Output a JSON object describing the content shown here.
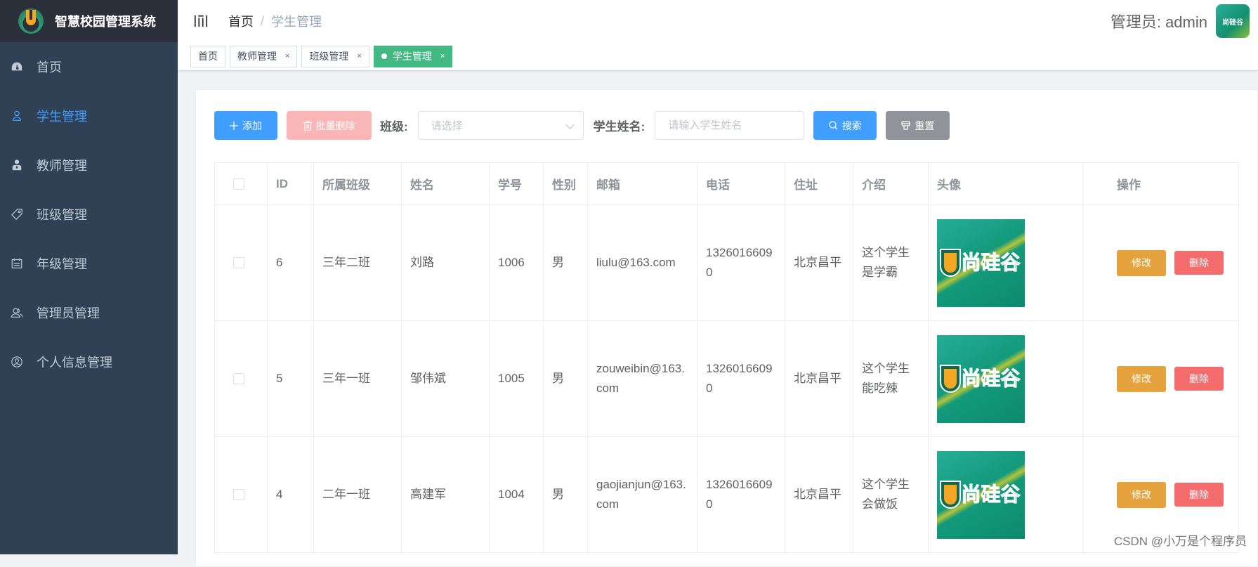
{
  "app": {
    "title": "智慧校园管理系统"
  },
  "sidebar": {
    "items": [
      {
        "label": "首页",
        "icon": "dashboard-icon",
        "active": false
      },
      {
        "label": "学生管理",
        "icon": "user-icon",
        "active": true
      },
      {
        "label": "教师管理",
        "icon": "teacher-icon",
        "active": false
      },
      {
        "label": "班级管理",
        "icon": "tag-icon",
        "active": false
      },
      {
        "label": "年级管理",
        "icon": "calendar-icon",
        "active": false
      },
      {
        "label": "管理员管理",
        "icon": "users-icon",
        "active": false
      },
      {
        "label": "个人信息管理",
        "icon": "user-circle-icon",
        "active": false
      }
    ]
  },
  "header": {
    "breadcrumb": {
      "home": "首页",
      "sep": "/",
      "current": "学生管理"
    },
    "user_label": "管理员: admin",
    "avatar_text": "尚硅谷"
  },
  "tags": [
    {
      "label": "首页",
      "closable": false,
      "active": false
    },
    {
      "label": "教师管理",
      "closable": true,
      "active": false
    },
    {
      "label": "班级管理",
      "closable": true,
      "active": false
    },
    {
      "label": "学生管理",
      "closable": true,
      "active": true
    }
  ],
  "tag_close": "×",
  "toolbar": {
    "add_label": "添加",
    "batch_delete_label": "批量删除",
    "class_label": "班级:",
    "class_placeholder": "请选择",
    "name_label": "学生姓名:",
    "name_placeholder": "请输入学生姓名",
    "name_value": "",
    "search_label": "搜索",
    "reset_label": "重置"
  },
  "table": {
    "columns": [
      "",
      "ID",
      "所属班级",
      "姓名",
      "学号",
      "性别",
      "邮箱",
      "电话",
      "住址",
      "介绍",
      "头像",
      "操作"
    ],
    "rows": [
      {
        "id": "6",
        "class": "三年二班",
        "name": "刘路",
        "sno": "1006",
        "gender": "男",
        "email": "liulu@163.com",
        "phone": "13260166090",
        "address": "北京昌平",
        "intro": "这个学生是学霸",
        "photo_text": "尚硅谷"
      },
      {
        "id": "5",
        "class": "三年一班",
        "name": "邹伟斌",
        "sno": "1005",
        "gender": "男",
        "email": "zouweibin@163.com",
        "phone": "13260166090",
        "address": "北京昌平",
        "intro": "这个学生能吃辣",
        "photo_text": "尚硅谷"
      },
      {
        "id": "4",
        "class": "二年一班",
        "name": "高建军",
        "sno": "1004",
        "gender": "男",
        "email": "gaojianjun@163.com",
        "phone": "13260166090",
        "address": "北京昌平",
        "intro": "这个学生会做饭",
        "photo_text": "尚硅谷"
      }
    ],
    "edit_label": "修改",
    "delete_label": "删除"
  },
  "watermark": "CSDN @小万是个程序员"
}
